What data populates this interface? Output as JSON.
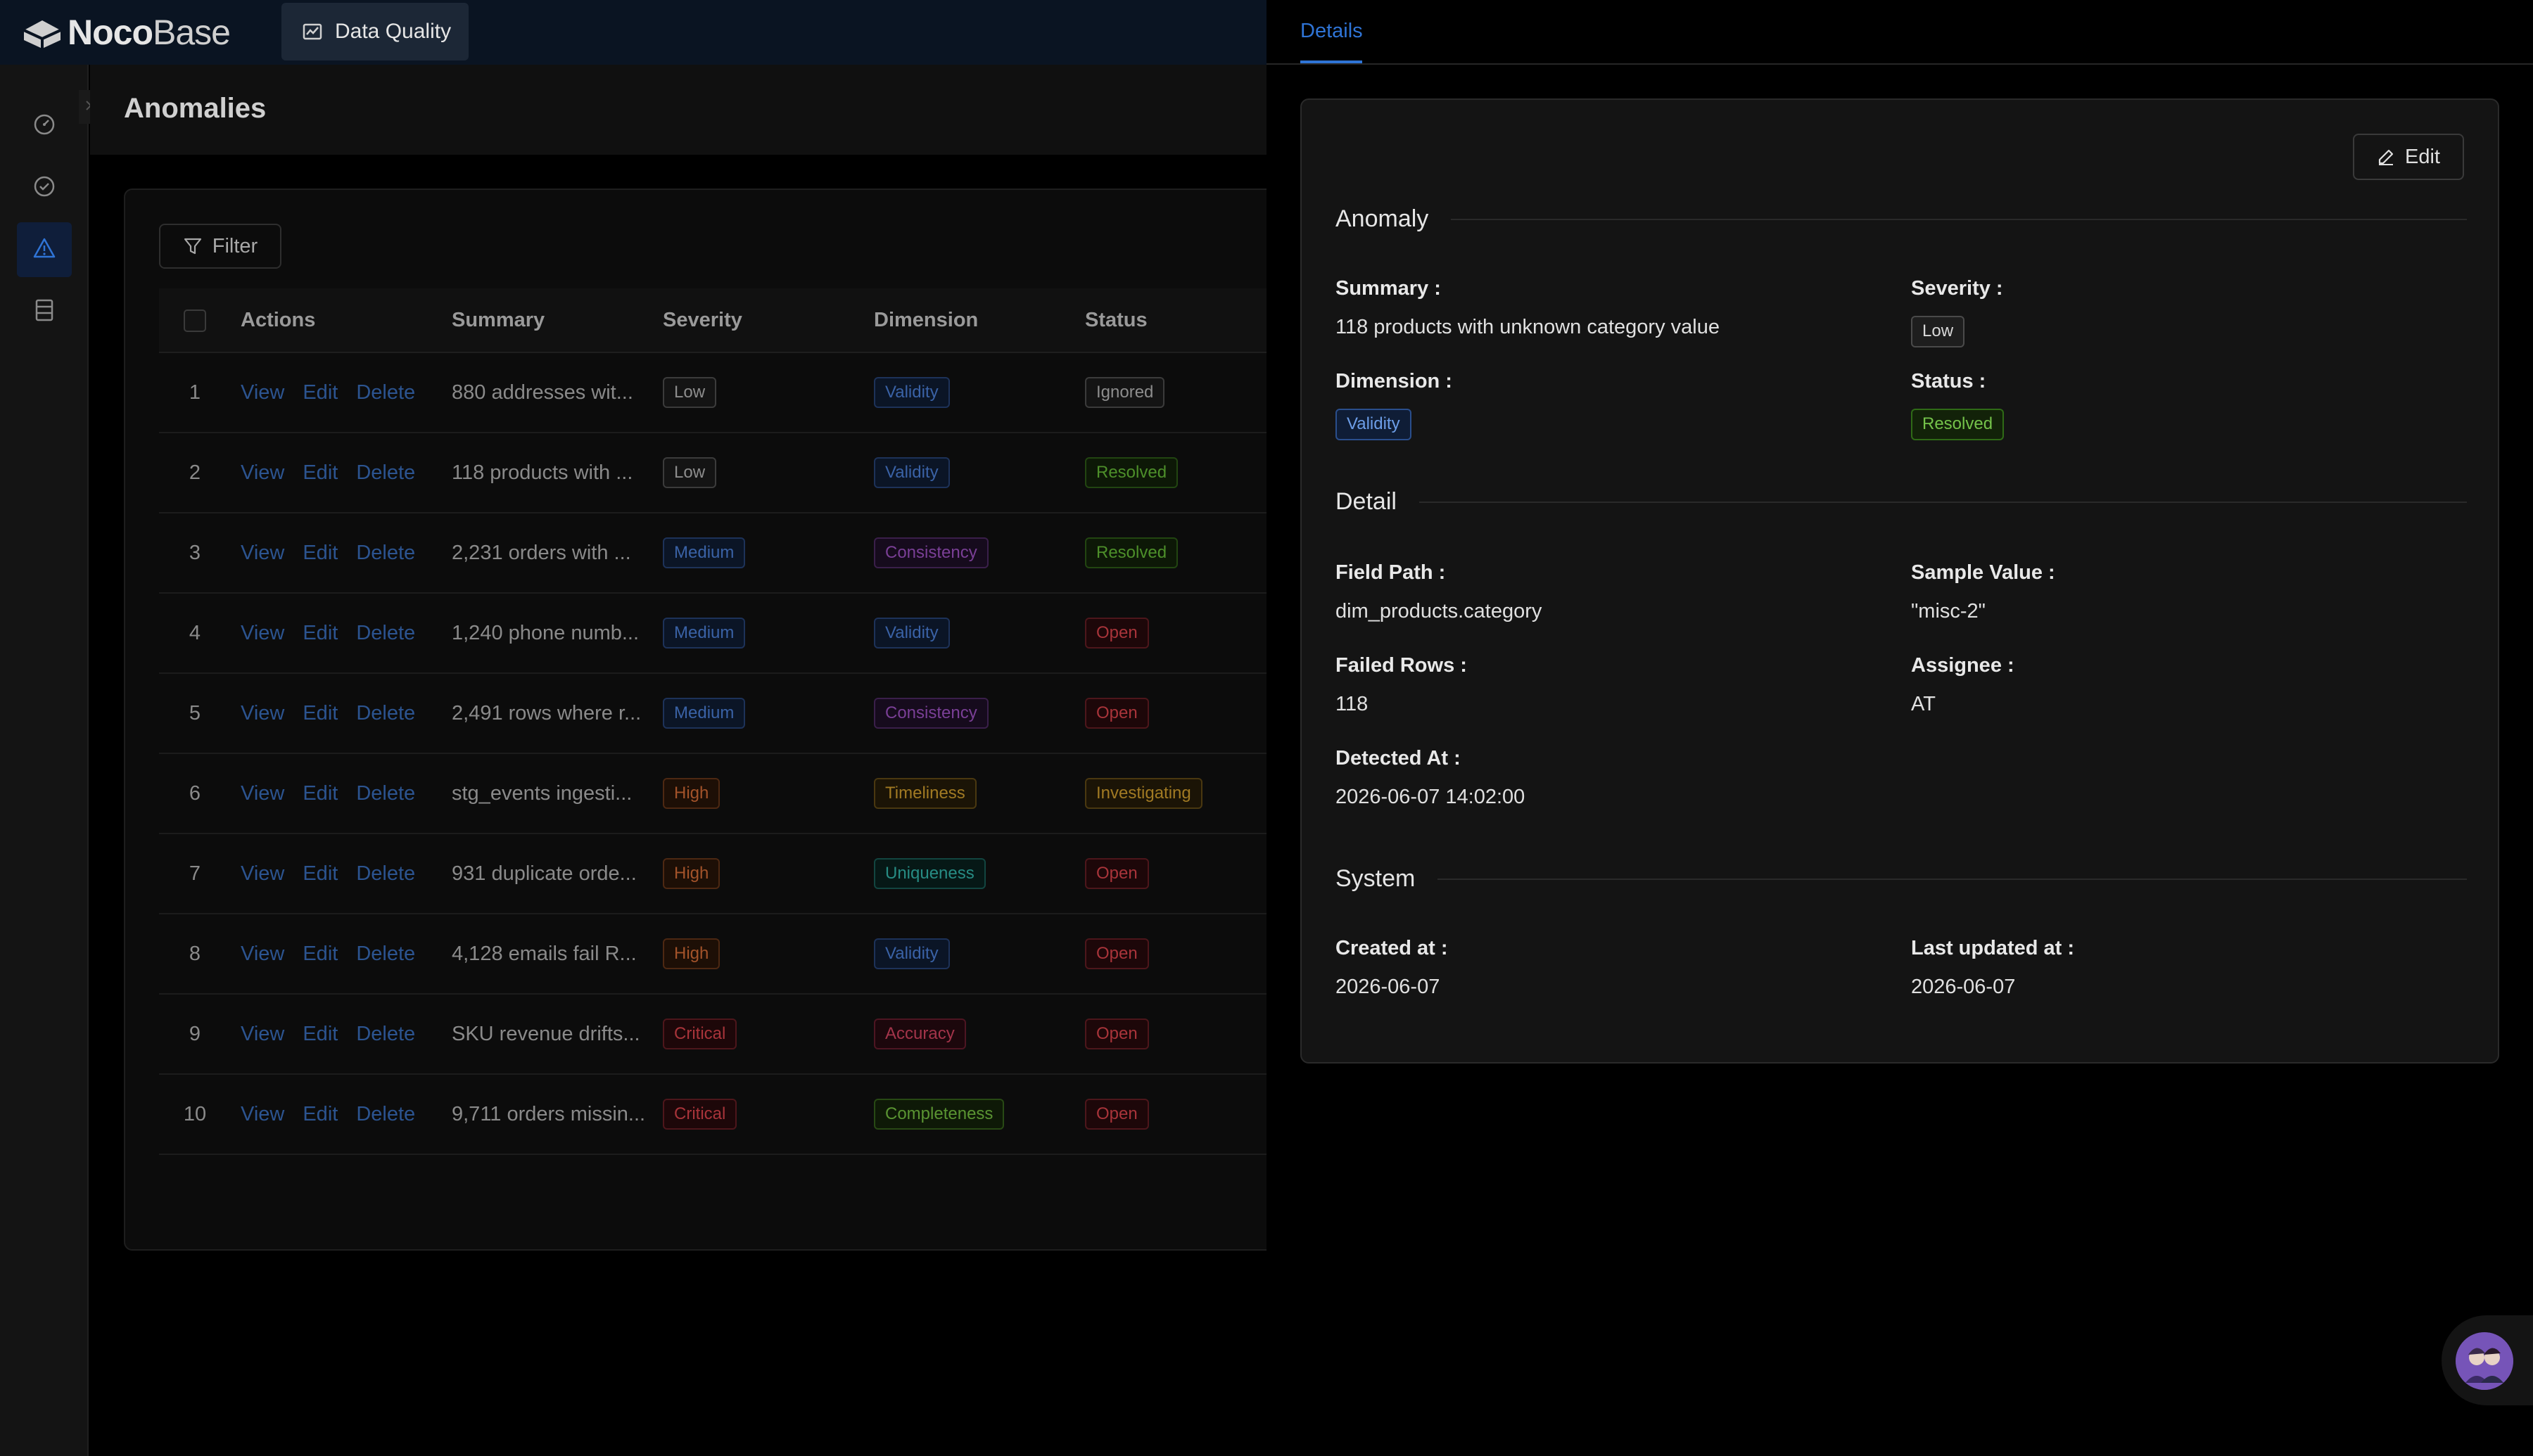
{
  "app": {
    "logo_main": "Noco",
    "logo_thin": "Base",
    "top_menu": "Data Quality",
    "logo_icon": "nocobase-logo-icon",
    "menu_icon": "chart-icon"
  },
  "sidebar": {
    "items": [
      "dashboard-icon",
      "check-circle-icon",
      "warning-icon",
      "table-icon"
    ],
    "active": 2
  },
  "page": {
    "title": "Anomalies"
  },
  "table": {
    "filter_label": "Filter",
    "headers": {
      "actions": "Actions",
      "summary": "Summary",
      "severity": "Severity",
      "dimension": "Dimension",
      "status": "Status"
    },
    "action_labels": {
      "view": "View",
      "edit": "Edit",
      "delete": "Delete"
    },
    "rows": [
      {
        "idx": "1",
        "summary": "880 addresses wit...",
        "severity": "Low",
        "dimension": "Validity",
        "status": "Ignored"
      },
      {
        "idx": "2",
        "summary": "118 products with ...",
        "severity": "Low",
        "dimension": "Validity",
        "status": "Resolved"
      },
      {
        "idx": "3",
        "summary": "2,231 orders with ...",
        "severity": "Medium",
        "dimension": "Consistency",
        "status": "Resolved"
      },
      {
        "idx": "4",
        "summary": "1,240 phone numb...",
        "severity": "Medium",
        "dimension": "Validity",
        "status": "Open"
      },
      {
        "idx": "5",
        "summary": "2,491 rows where r...",
        "severity": "Medium",
        "dimension": "Consistency",
        "status": "Open"
      },
      {
        "idx": "6",
        "summary": "stg_events ingesti...",
        "severity": "High",
        "dimension": "Timeliness",
        "status": "Investigating"
      },
      {
        "idx": "7",
        "summary": "931 duplicate orde...",
        "severity": "High",
        "dimension": "Uniqueness",
        "status": "Open"
      },
      {
        "idx": "8",
        "summary": "4,128 emails fail R...",
        "severity": "High",
        "dimension": "Validity",
        "status": "Open"
      },
      {
        "idx": "9",
        "summary": "SKU revenue drifts...",
        "severity": "Critical",
        "dimension": "Accuracy",
        "status": "Open"
      },
      {
        "idx": "10",
        "summary": "9,711 orders missin...",
        "severity": "Critical",
        "dimension": "Completeness",
        "status": "Open"
      }
    ]
  },
  "drawer": {
    "tab": "Details",
    "edit_label": "Edit",
    "sections": {
      "anomaly": {
        "title": "Anomaly",
        "summary_label": "Summary :",
        "summary_value": "118 products with unknown category value",
        "severity_label": "Severity :",
        "severity_value": "Low",
        "dimension_label": "Dimension :",
        "dimension_value": "Validity",
        "status_label": "Status :",
        "status_value": "Resolved"
      },
      "detail": {
        "title": "Detail",
        "field_path_label": "Field Path :",
        "field_path_value": "dim_products.category",
        "sample_value_label": "Sample Value :",
        "sample_value_value": "\"misc-2\"",
        "failed_rows_label": "Failed Rows :",
        "failed_rows_value": "118",
        "assignee_label": "Assignee :",
        "assignee_value": "AT",
        "detected_at_label": "Detected At :",
        "detected_at_value": "2026-06-07 14:02:00"
      },
      "system": {
        "title": "System",
        "created_at_label": "Created at :",
        "created_at_value": "2026-06-07",
        "updated_at_label": "Last updated at :",
        "updated_at_value": "2026-06-07"
      }
    }
  },
  "colors": {
    "accent": "#2f74d6",
    "topbar": "#0a1422",
    "link_dim": "#2c5490"
  }
}
